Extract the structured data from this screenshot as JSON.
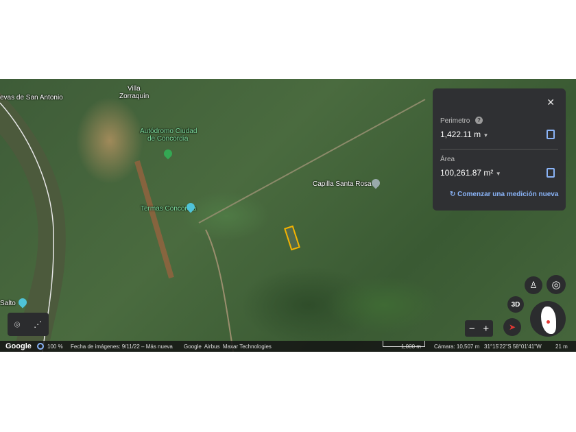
{
  "map": {
    "labels": [
      "evas de San Antonio",
      "Villa",
      "Zorraquín",
      "Autódromo Ciudad",
      "de Concordia",
      "Termas Concordia",
      "Capilla Santa Rosa",
      "Salto"
    ]
  },
  "measure": {
    "perimeter_label": "Perimetro",
    "perimeter_value": "1,422.11 m",
    "area_label": "Área",
    "area_value": "100,261.87 m²",
    "new_measure": "Comenzar una medición nueva",
    "close": "✕",
    "help": "?"
  },
  "controls": {
    "three_d": "3D",
    "zoom_in": "+",
    "zoom_out": "−"
  },
  "status": {
    "brand": "Google",
    "loading": "100 %",
    "imagery_date": "Fecha de imágenes: 9/11/22 – Más nueva",
    "credits": "Google  Airbus  Maxar Technologies",
    "scale": "1,000 m",
    "camera": "Cámara: 10,507 m",
    "coords": "31°15'22\"S 58°01'41\"W",
    "elevation": "21 m"
  },
  "colors": {
    "accent": "#8ab4f8",
    "polygon": "#f5b400"
  }
}
